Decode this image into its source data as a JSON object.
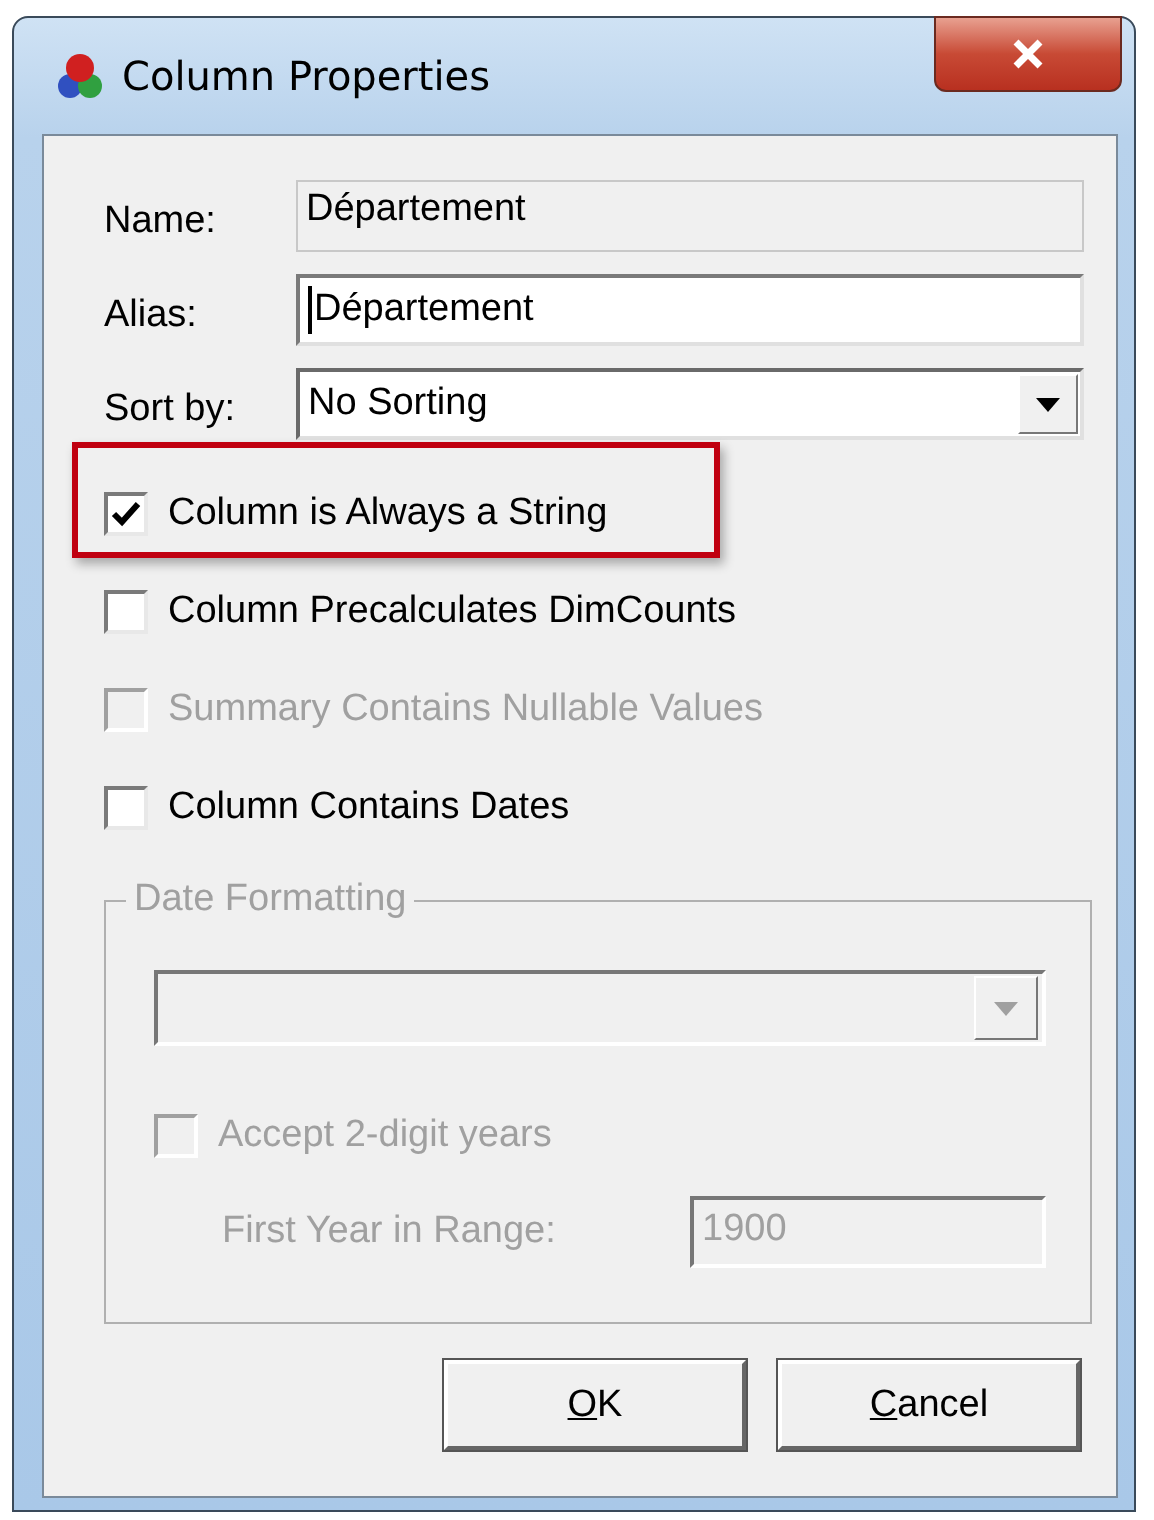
{
  "window": {
    "title": "Column Properties"
  },
  "fields": [
    {
      "kind": "readonly",
      "label": "Name:",
      "value": "Département"
    },
    {
      "kind": "text",
      "label": "Alias:",
      "value": "Département"
    },
    {
      "kind": "dropdown",
      "label": "Sort by:",
      "value": "No Sorting"
    }
  ],
  "options": [
    {
      "label": "Column is Always a String",
      "checked": true,
      "disabled": false,
      "highlighted": true
    },
    {
      "label": "Column Precalculates DimCounts",
      "checked": false,
      "disabled": false,
      "highlighted": false
    },
    {
      "label": "Summary Contains Nullable Values",
      "checked": false,
      "disabled": true,
      "highlighted": false
    },
    {
      "label": "Column Contains Dates",
      "checked": false,
      "disabled": false,
      "highlighted": false
    }
  ],
  "date_formatting": {
    "title": "Date Formatting",
    "disabled": true,
    "accept_two_digit": {
      "label": "Accept 2-digit years",
      "checked": false
    },
    "first_year": {
      "label": "First Year in Range:",
      "value": "1900"
    }
  },
  "buttons": [
    {
      "label": "OK",
      "underline_first": true
    },
    {
      "label": "Cancel",
      "underline_first": true
    }
  ]
}
